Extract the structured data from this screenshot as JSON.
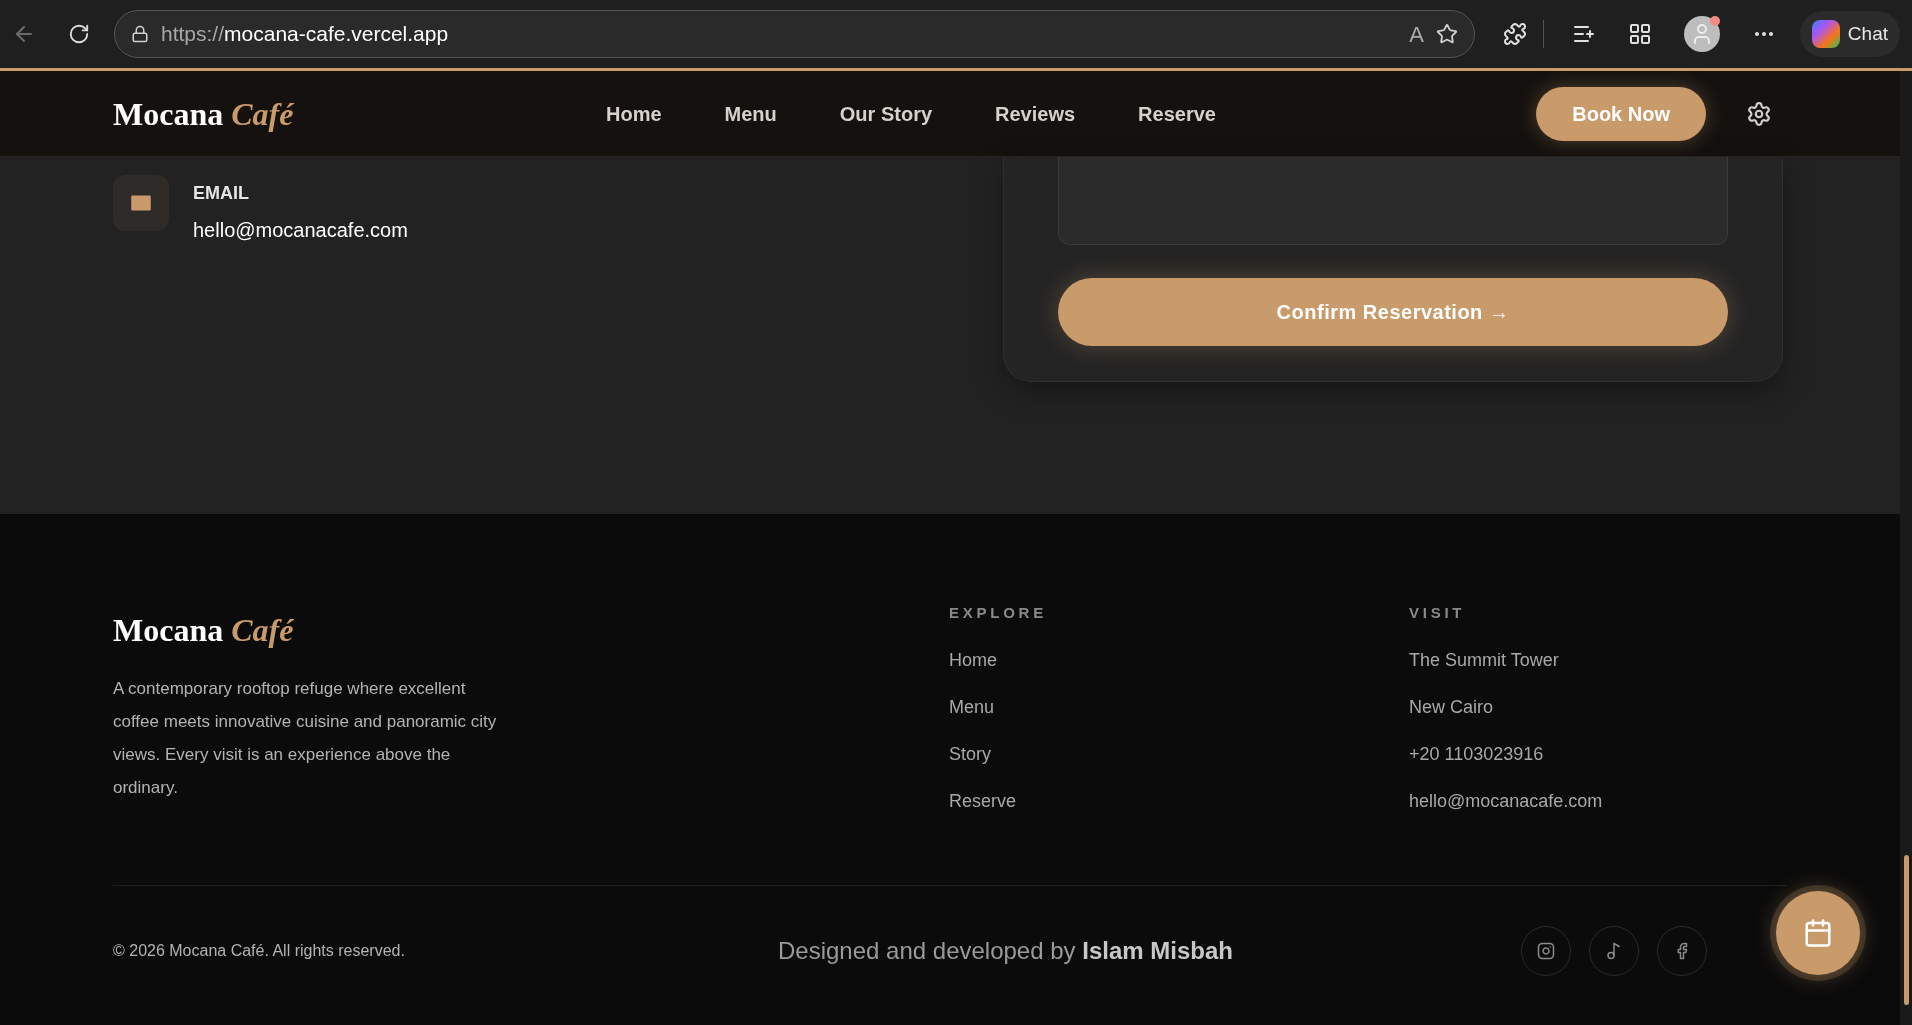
{
  "browser": {
    "url_scheme": "https://",
    "url_host": "mocana-cafe.vercel.app",
    "read_aloud": "A",
    "chat_label": "Chat"
  },
  "nav": {
    "logo_main": "Mocana",
    "logo_accent": "Café",
    "links": [
      {
        "label": "Home"
      },
      {
        "label": "Menu"
      },
      {
        "label": "Our Story"
      },
      {
        "label": "Reviews"
      },
      {
        "label": "Reserve"
      }
    ],
    "cta": "Book Now"
  },
  "contact": {
    "label": "EMAIL",
    "value": "hello@mocanacafe.com"
  },
  "reservation": {
    "submit": "Confirm Reservation →"
  },
  "footer": {
    "logo_main": "Mocana",
    "logo_accent": "Café",
    "about": "A contemporary rooftop refuge where excellent coffee meets innovative cuisine and panoramic city views. Every visit is an experience above the ordinary.",
    "columns": [
      {
        "heading": "EXPLORE",
        "items": [
          "Home",
          "Menu",
          "Story",
          "Reserve"
        ]
      },
      {
        "heading": "VISIT",
        "items": [
          "The Summit Tower",
          "New Cairo",
          "+20 1103023916",
          "hello@mocanacafe.com"
        ]
      }
    ],
    "copyright": "© 2026 Mocana Café. All rights reserved.",
    "credit": "Designed and developed by **Islam Misbah**",
    "socials": [
      {
        "kind": "instagram"
      },
      {
        "kind": "tiktok"
      },
      {
        "kind": "facebook"
      }
    ]
  }
}
